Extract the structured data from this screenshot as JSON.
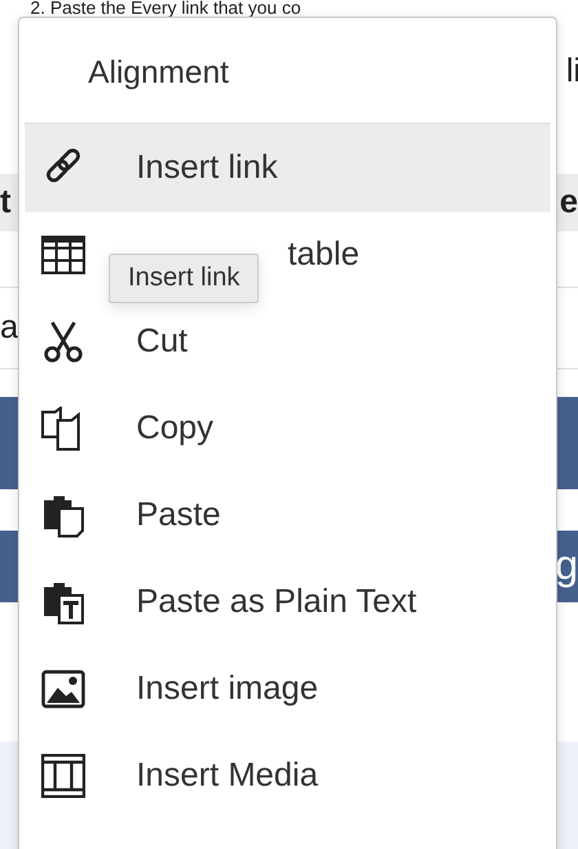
{
  "page": {
    "lines": [
      {
        "text": "2. Paste the Every link that you co"
      },
      {
        "right": "li"
      }
    ],
    "table_header": {
      "left": "t",
      "right": "e"
    },
    "table_row": {
      "left": "a"
    },
    "banner": {
      "right": "g"
    }
  },
  "menu": {
    "header": "Alignment",
    "items": [
      {
        "kind": "link",
        "label": "Insert link",
        "selected": true,
        "covered": false
      },
      {
        "kind": "table",
        "label": "table",
        "selected": false,
        "covered": true
      },
      {
        "kind": "cut",
        "label": "Cut",
        "selected": false,
        "covered": false
      },
      {
        "kind": "copy",
        "label": "Copy",
        "selected": false,
        "covered": false
      },
      {
        "kind": "paste",
        "label": "Paste",
        "selected": false,
        "covered": false
      },
      {
        "kind": "paste-text",
        "label": "Paste as Plain Text",
        "selected": false,
        "covered": false
      },
      {
        "kind": "image",
        "label": "Insert image",
        "selected": false,
        "covered": false
      },
      {
        "kind": "media",
        "label": "Insert Media",
        "selected": false,
        "covered": false
      }
    ]
  },
  "tooltip": {
    "text": "Insert link"
  }
}
